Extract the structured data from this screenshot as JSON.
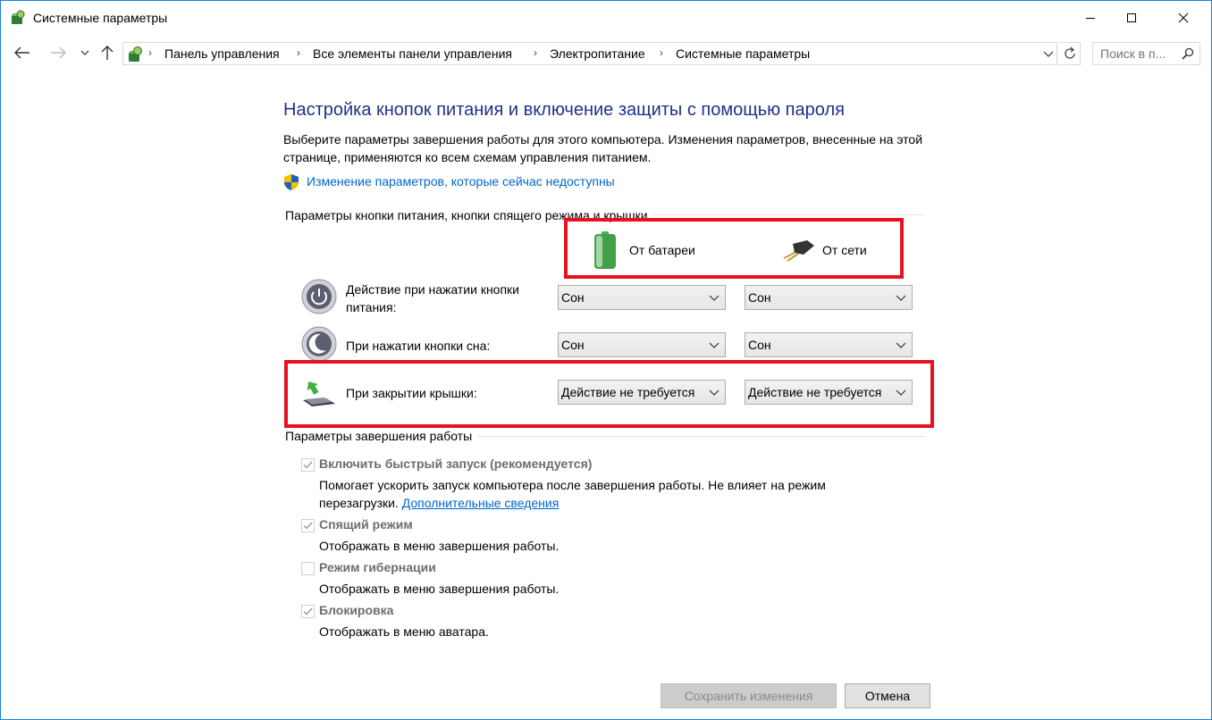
{
  "window": {
    "title": "Системные параметры"
  },
  "address": {
    "crumbs": [
      "Панель управления",
      "Все элементы панели управления",
      "Электропитание",
      "Системные параметры"
    ]
  },
  "search": {
    "placeholder": "Поиск в п..."
  },
  "main": {
    "heading": "Настройка кнопок питания и включение защиты с помощью пароля",
    "description": "Выберите параметры завершения работы для этого компьютера. Изменения параметров, внесенные на этой странице, применяются ко всем схемам управления питанием.",
    "change_link": "Изменение параметров, которые сейчас недоступны"
  },
  "power_buttons": {
    "group_label": "Параметры кнопки питания, кнопки спящего режима и крышки",
    "col_battery": "От батареи",
    "col_ac": "От сети",
    "rows": [
      {
        "label": "Действие при нажатии кнопки питания:",
        "battery": "Сон",
        "ac": "Сон"
      },
      {
        "label": "При нажатии кнопки сна:",
        "battery": "Сон",
        "ac": "Сон"
      },
      {
        "label": "При закрытии крышки:",
        "battery": "Действие не требуется",
        "ac": "Действие не требуется"
      }
    ]
  },
  "shutdown": {
    "group_label": "Параметры завершения работы",
    "items": [
      {
        "label": "Включить быстрый запуск (рекомендуется)",
        "checked": true,
        "desc1": "Помогает ускорить запуск компьютера после завершения работы. Не влияет на режим",
        "desc2": "перезагрузки.",
        "link": "Дополнительные сведения"
      },
      {
        "label": "Спящий режим",
        "checked": true,
        "desc1": "Отображать в меню завершения работы."
      },
      {
        "label": "Режим гибернации",
        "checked": false,
        "desc1": "Отображать в меню завершения работы."
      },
      {
        "label": "Блокировка",
        "checked": true,
        "desc1": "Отображать в меню аватара."
      }
    ]
  },
  "buttons": {
    "save": "Сохранить изменения",
    "cancel": "Отмена"
  },
  "colors": {
    "heading": "#1e3287",
    "link": "#0066cc",
    "highlight": "#e81123",
    "window_border": "#1883d7"
  }
}
